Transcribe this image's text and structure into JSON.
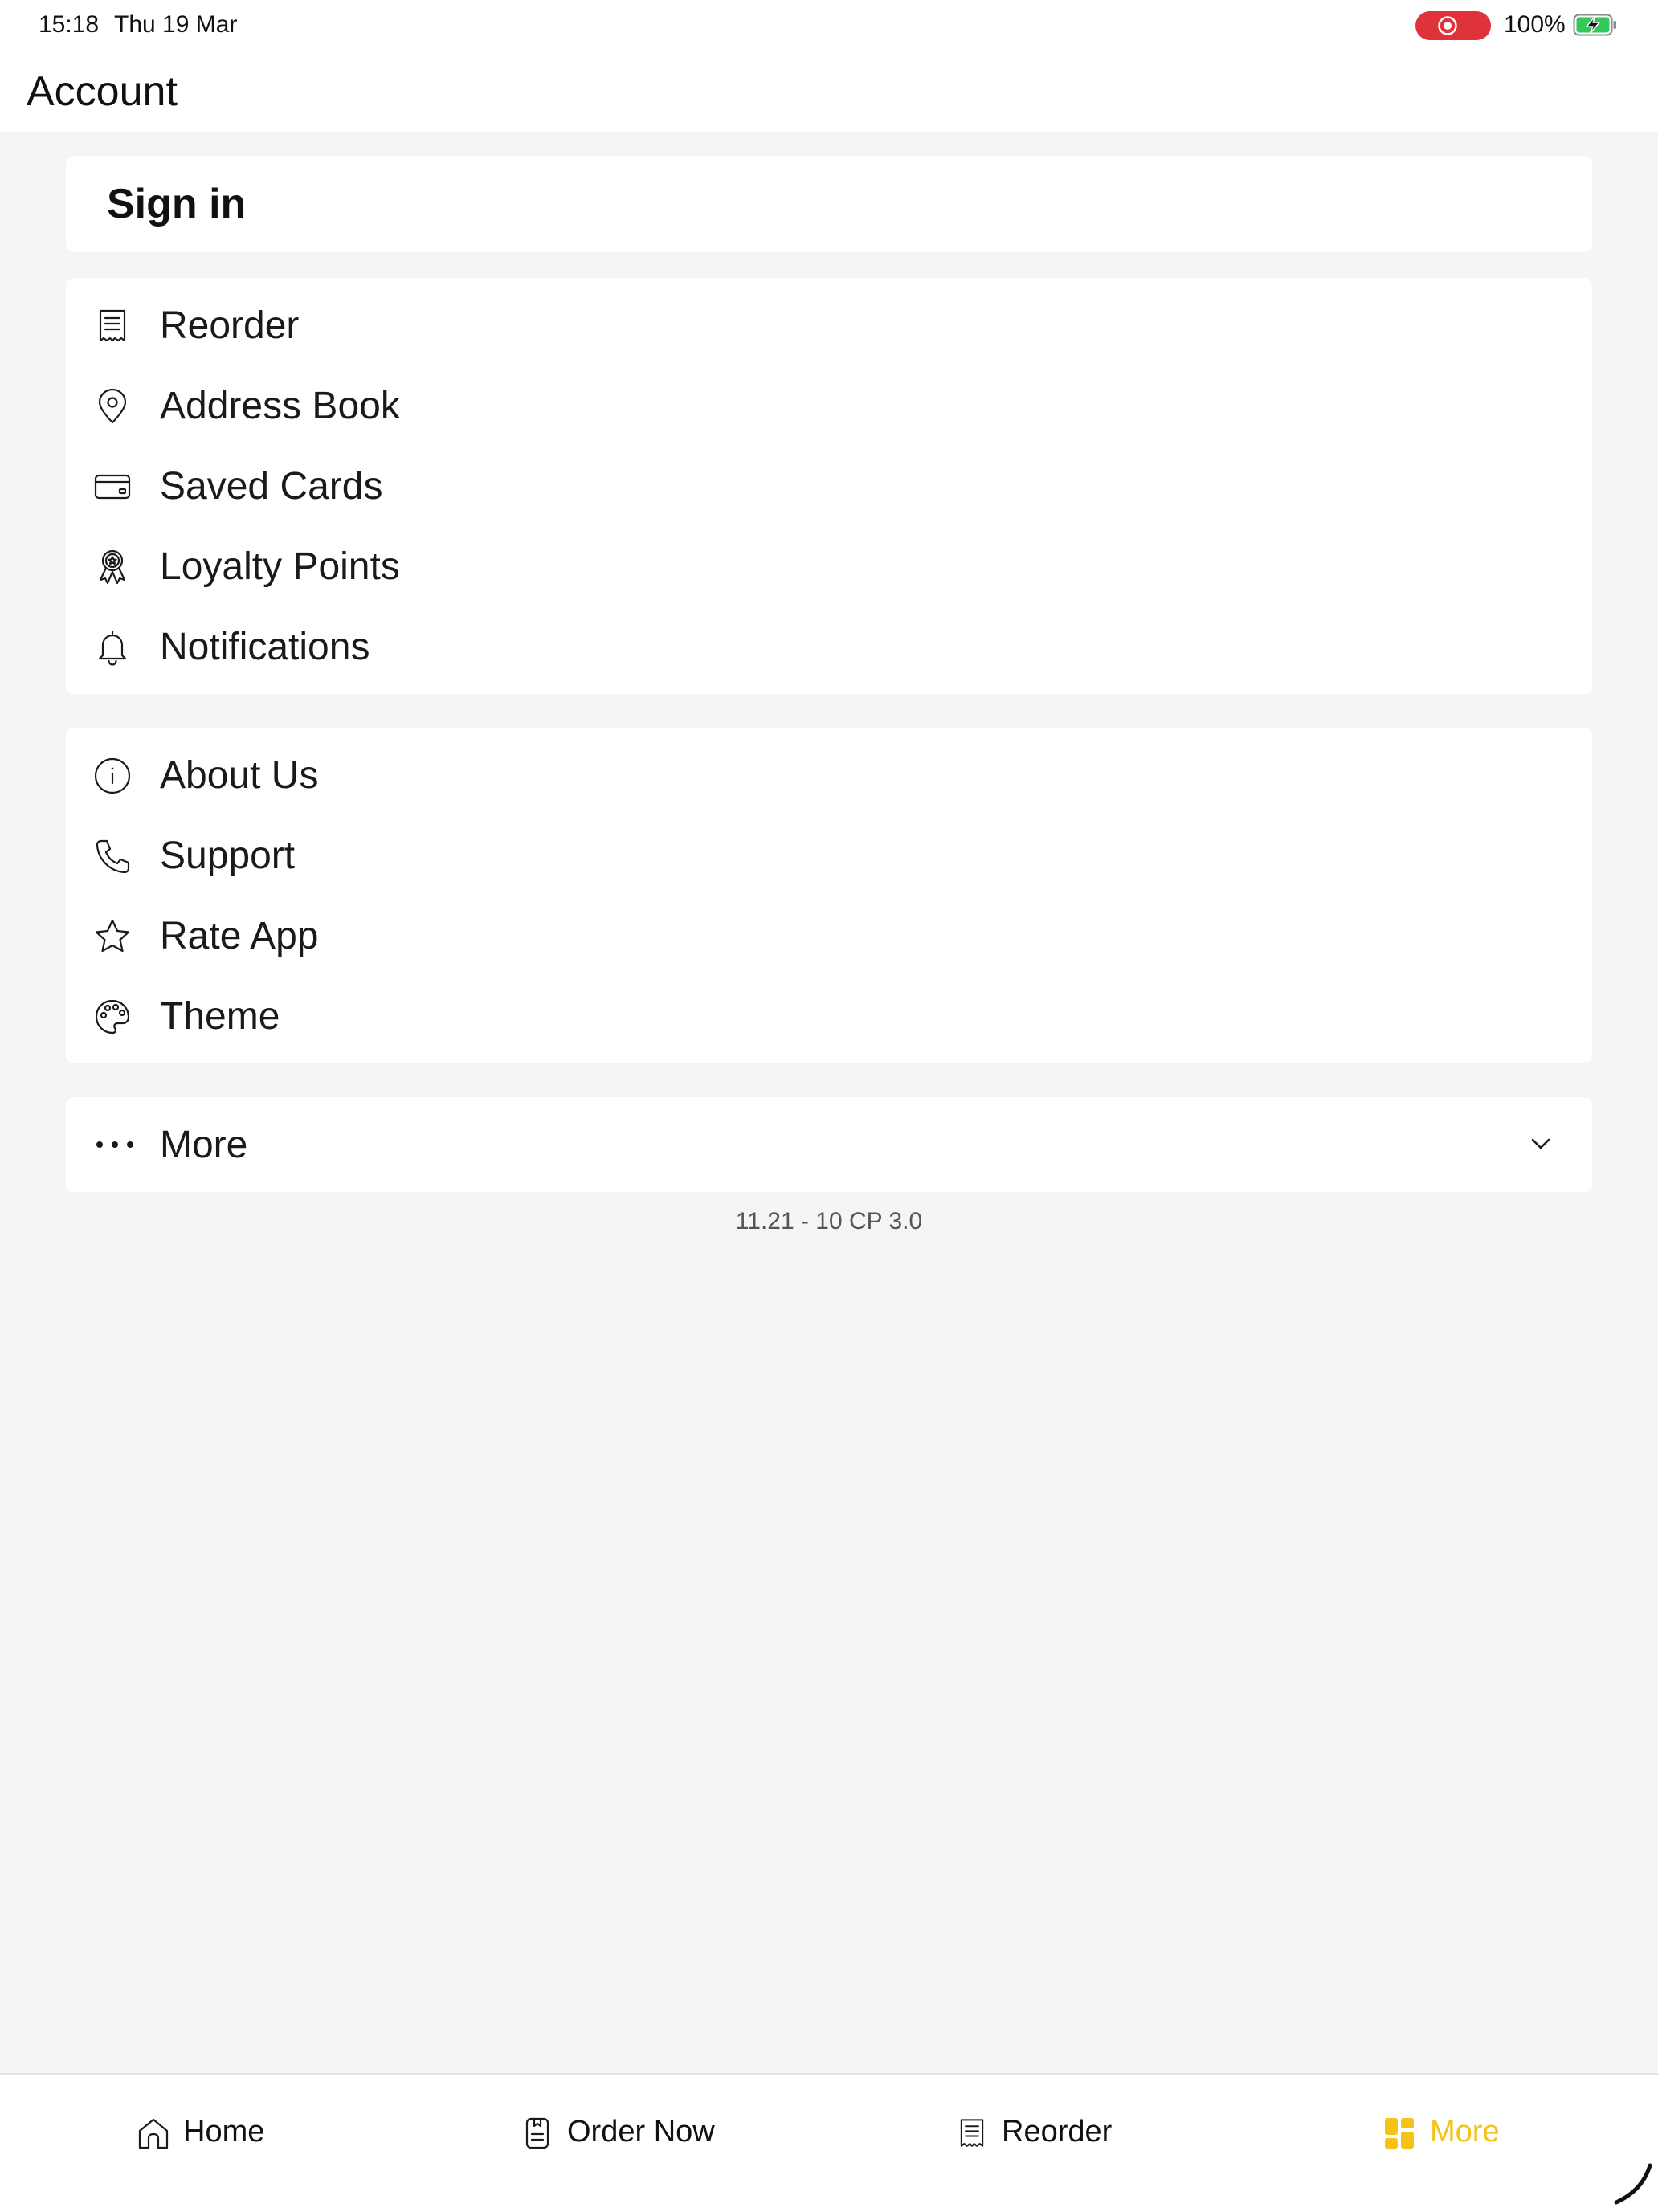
{
  "status_bar": {
    "time": "15:18",
    "date": "Thu 19 Mar",
    "battery_percent": "100%",
    "recording_color": "#e0323a",
    "battery_color": "#34c759"
  },
  "header": {
    "title": "Account"
  },
  "signin": {
    "label": "Sign in"
  },
  "account_menu": [
    {
      "label": "Reorder",
      "icon": "receipt-icon"
    },
    {
      "label": "Address Book",
      "icon": "location-pin-icon"
    },
    {
      "label": "Saved Cards",
      "icon": "credit-card-icon"
    },
    {
      "label": "Loyalty Points",
      "icon": "award-ribbon-icon"
    },
    {
      "label": "Notifications",
      "icon": "bell-icon"
    }
  ],
  "info_menu": [
    {
      "label": "About Us",
      "icon": "info-icon"
    },
    {
      "label": "Support",
      "icon": "phone-icon"
    },
    {
      "label": "Rate App",
      "icon": "star-icon"
    },
    {
      "label": "Theme",
      "icon": "palette-icon"
    }
  ],
  "more_section": {
    "label": "More",
    "icon": "ellipsis-icon",
    "expanded": false
  },
  "version": "11.21 - 10 CP 3.0",
  "tab_bar": {
    "accent_color": "#f5c218",
    "active_tab": "More",
    "tabs": [
      {
        "label": "Home",
        "icon": "home-icon"
      },
      {
        "label": "Order Now",
        "icon": "menu-booklet-icon"
      },
      {
        "label": "Reorder",
        "icon": "receipt-icon"
      },
      {
        "label": "More",
        "icon": "grid-icon"
      }
    ]
  }
}
